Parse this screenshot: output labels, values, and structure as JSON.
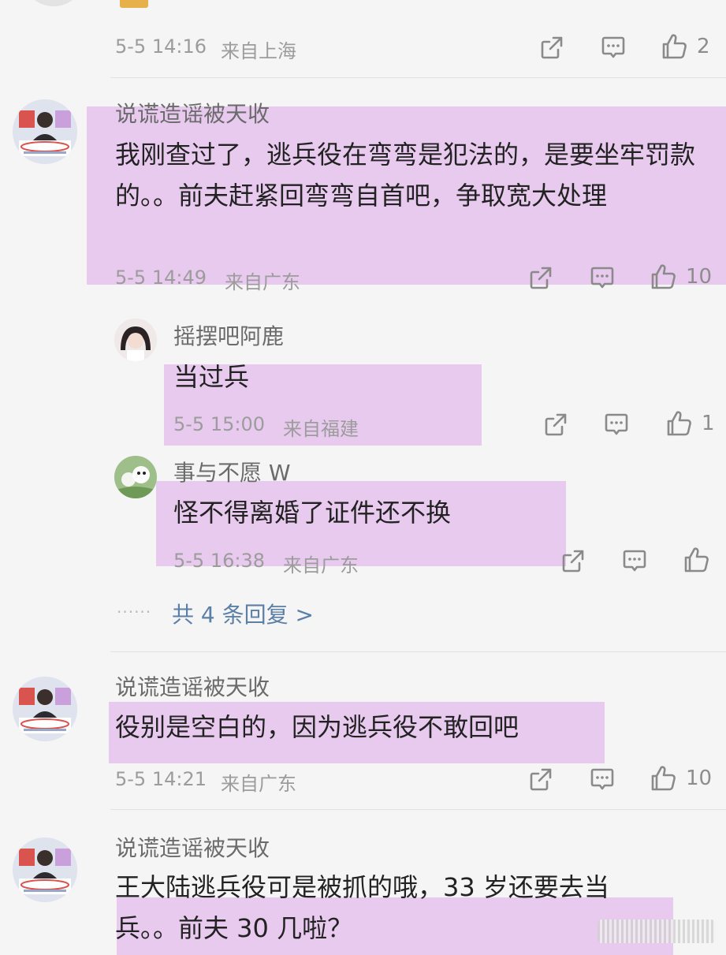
{
  "top_meta": {
    "time": "5-5 14:16",
    "location": "来自上海",
    "likes": "2"
  },
  "comments": [
    {
      "user": "说谎造谣被天收",
      "text": "我刚查过了，逃兵役在弯弯是犯法的，是要坐牢罚款的。。前夫赶紧回弯弯自首吧，争取宽大处理",
      "time": "5-5 14:49",
      "location": "来自广东",
      "likes": "10",
      "replies": [
        {
          "user": "摇摆吧阿鹿",
          "text": "当过兵",
          "time": "5-5 15:00",
          "location": "来自福建",
          "likes": "1"
        },
        {
          "user": "事与不愿 W",
          "text": "怪不得离婚了证件还不换",
          "time": "5-5 16:38",
          "location": "来自广东",
          "likes": ""
        }
      ],
      "more_replies": "共 4 条回复 >"
    },
    {
      "user": "说谎造谣被天收",
      "text": "役别是空白的，因为逃兵役不敢回吧",
      "time": "5-5 14:21",
      "location": "来自广东",
      "likes": "10"
    },
    {
      "user": "说谎造谣被天收",
      "text": "王大陆逃兵役可是被抓的哦，33 岁还要去当兵。。前夫 30 几啦？"
    }
  ],
  "icons": {
    "share": "share-icon",
    "comment": "comment-icon",
    "like": "thumbs-up-icon"
  },
  "colors": {
    "highlight": "#e6c6ee",
    "link": "#5b7fa6",
    "meta": "#9c9c9c"
  }
}
